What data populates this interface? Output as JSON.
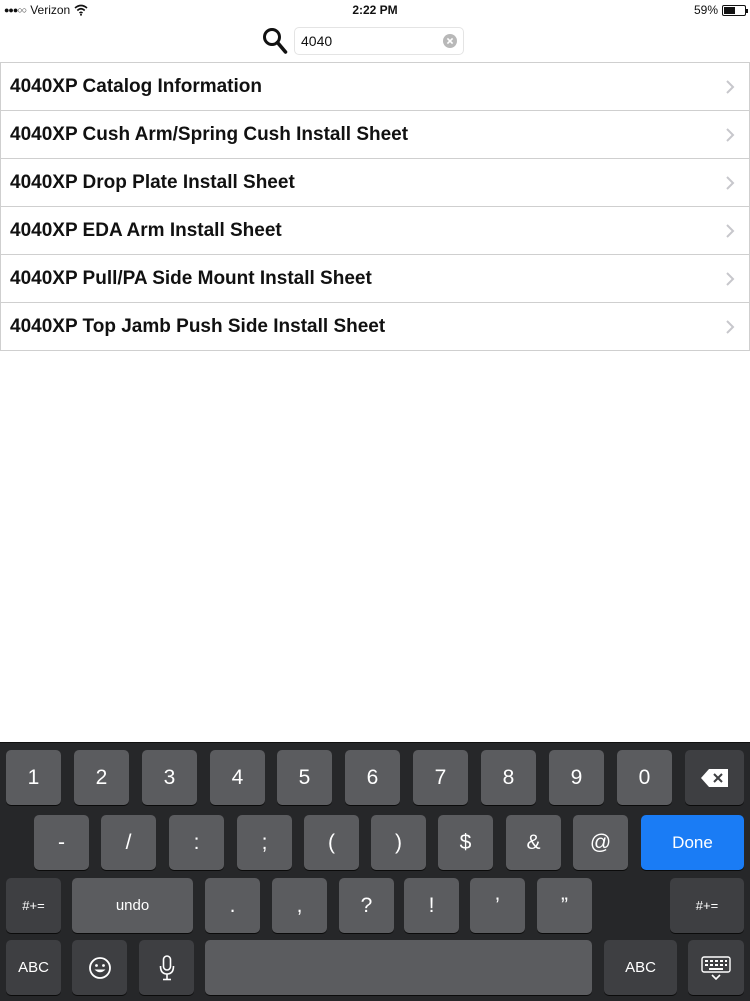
{
  "status_bar": {
    "carrier": "Verizon",
    "signal_dots": "●●●○○",
    "time": "2:22 PM",
    "battery_percent": "59%",
    "battery_level": 0.59
  },
  "search": {
    "value": "4040",
    "placeholder": ""
  },
  "results": [
    {
      "label": "4040XP Catalog Information"
    },
    {
      "label": "4040XP Cush Arm/Spring Cush Install Sheet"
    },
    {
      "label": "4040XP Drop Plate Install Sheet"
    },
    {
      "label": "4040XP EDA Arm Install Sheet"
    },
    {
      "label": "4040XP Pull/PA Side Mount Install Sheet"
    },
    {
      "label": "4040XP Top Jamb Push Side Install Sheet"
    }
  ],
  "keyboard": {
    "row1": [
      "1",
      "2",
      "3",
      "4",
      "5",
      "6",
      "7",
      "8",
      "9",
      "0"
    ],
    "row2": [
      "-",
      "/",
      ":",
      ";",
      "(",
      ")",
      "$",
      "&",
      "@"
    ],
    "done_label": "Done",
    "row3_left": "#+=",
    "undo_label": "undo",
    "row3": [
      ".",
      ",",
      "?",
      "!",
      "’",
      "”"
    ],
    "row3_right": "#+=",
    "abc_left": "ABC",
    "abc_right": "ABC"
  },
  "colors": {
    "accent": "#1a7cf5",
    "keyboard_bg": "#262729",
    "key": "#5b5c5f",
    "key_dark": "#3e3f42"
  }
}
